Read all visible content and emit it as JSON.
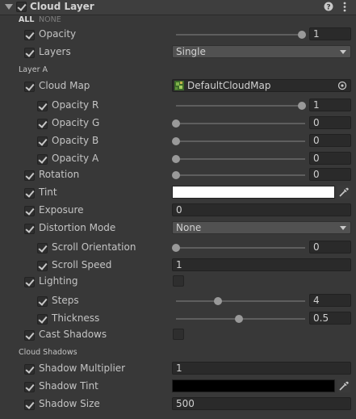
{
  "header": {
    "title": "Cloud Layer",
    "enabled": true
  },
  "toggle_all": {
    "all": "ALL",
    "none": "NONE"
  },
  "sections": {
    "layer_a": "Layer A",
    "cloud_shadows": "Cloud Shadows"
  },
  "rows": {
    "opacity": {
      "label": "Opacity",
      "checked": true,
      "value": "1",
      "slider": 1.0
    },
    "layers": {
      "label": "Layers",
      "checked": true,
      "value": "Single"
    },
    "cloud_map": {
      "label": "Cloud Map",
      "checked": true,
      "value": "DefaultCloudMap"
    },
    "opacity_r": {
      "label": "Opacity R",
      "checked": true,
      "value": "1",
      "slider": 1.0
    },
    "opacity_g": {
      "label": "Opacity G",
      "checked": true,
      "value": "0",
      "slider": 0.0
    },
    "opacity_b": {
      "label": "Opacity B",
      "checked": true,
      "value": "0",
      "slider": 0.0
    },
    "opacity_a": {
      "label": "Opacity A",
      "checked": true,
      "value": "0",
      "slider": 0.0
    },
    "rotation": {
      "label": "Rotation",
      "checked": true,
      "value": "0",
      "slider": 0.0
    },
    "tint": {
      "label": "Tint",
      "checked": true,
      "color": "#ffffff"
    },
    "exposure": {
      "label": "Exposure",
      "checked": true,
      "value": "0"
    },
    "distortion_mode": {
      "label": "Distortion Mode",
      "checked": true,
      "value": "None"
    },
    "scroll_orientation": {
      "label": "Scroll Orientation",
      "checked": true,
      "value": "0",
      "slider": 0.0
    },
    "scroll_speed": {
      "label": "Scroll Speed",
      "checked": true,
      "value": "1"
    },
    "lighting": {
      "label": "Lighting",
      "checked": true,
      "toggle": false
    },
    "steps": {
      "label": "Steps",
      "checked": true,
      "value": "4",
      "slider": 0.33
    },
    "thickness": {
      "label": "Thickness",
      "checked": true,
      "value": "0.5",
      "slider": 0.5
    },
    "cast_shadows": {
      "label": "Cast Shadows",
      "checked": true,
      "toggle": false
    },
    "shadow_multiplier": {
      "label": "Shadow Multiplier",
      "checked": true,
      "value": "1"
    },
    "shadow_tint": {
      "label": "Shadow Tint",
      "checked": true,
      "color": "#000000"
    },
    "shadow_size": {
      "label": "Shadow Size",
      "checked": true,
      "value": "500"
    }
  },
  "icons": {
    "help": "help-icon",
    "menu": "kebab-menu-icon",
    "object_picker": "target-icon",
    "eyedropper": "eyedropper-icon",
    "texture_thumb": "texture-icon"
  }
}
